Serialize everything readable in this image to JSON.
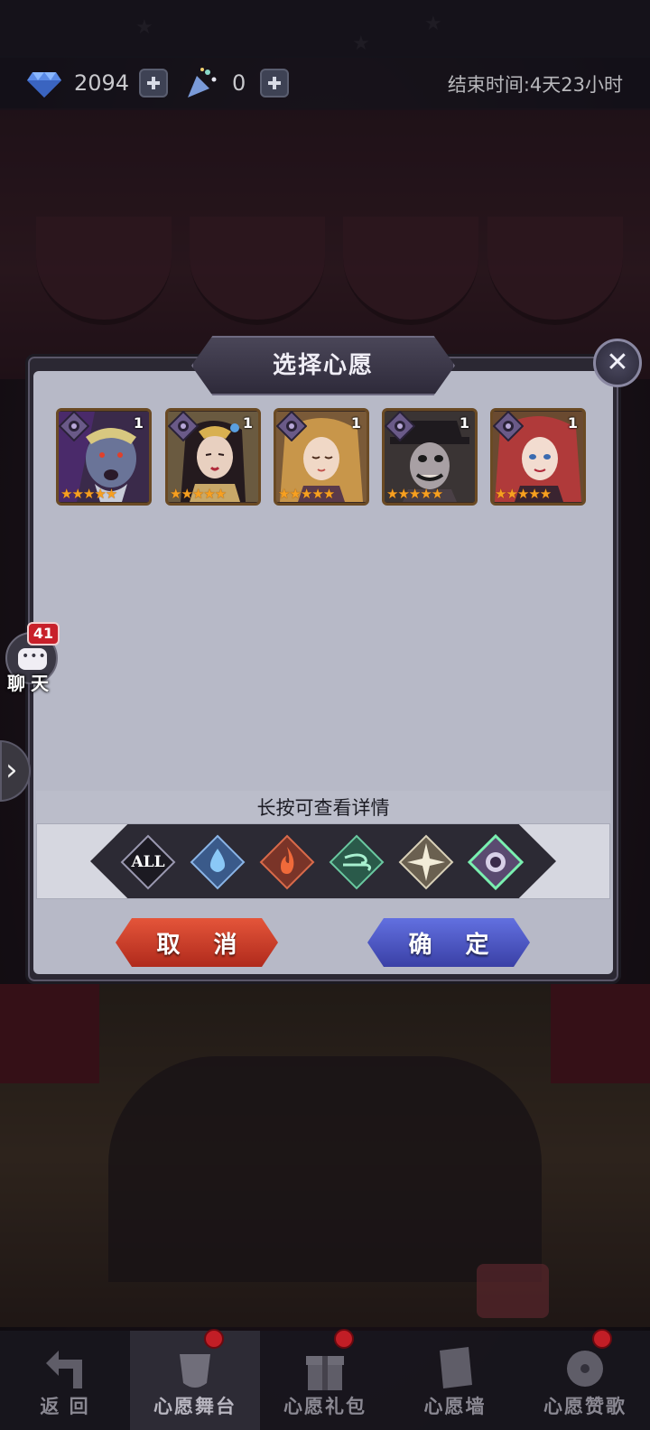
{
  "resources": {
    "gems": "2094",
    "tickets": "0",
    "end_time": "结束时间:4天23小时"
  },
  "dialog": {
    "title": "选择心愿",
    "hint": "长按可查看详情",
    "cancel_label": "取 消",
    "confirm_label": "确 定"
  },
  "heroes": [
    {
      "level": "1",
      "stars": "★★★★★",
      "faction": "shadow"
    },
    {
      "level": "1",
      "stars": "★★★★★",
      "faction": "shadow"
    },
    {
      "level": "1",
      "stars": "★★★★★",
      "faction": "shadow"
    },
    {
      "level": "1",
      "stars": "★★★★★",
      "faction": "shadow"
    },
    {
      "level": "1",
      "stars": "★★★★★",
      "faction": "shadow"
    }
  ],
  "filters": [
    {
      "label": "ALL",
      "icon": "all-icon"
    },
    {
      "label": "",
      "icon": "water-drop-icon"
    },
    {
      "label": "",
      "icon": "fire-icon"
    },
    {
      "label": "",
      "icon": "wind-icon"
    },
    {
      "label": "",
      "icon": "light-star-icon"
    },
    {
      "label": "",
      "icon": "shadow-eye-icon",
      "selected": true
    }
  ],
  "chat": {
    "badge": "41",
    "label": "聊天"
  },
  "nav": [
    {
      "label": "返 回"
    },
    {
      "label": "心愿舞台"
    },
    {
      "label": "心愿礼包"
    },
    {
      "label": "心愿墙"
    },
    {
      "label": "心愿赞歌"
    }
  ],
  "colors": {
    "cancel": "#d0412c",
    "confirm": "#4c56c8",
    "star": "#f7a020",
    "badge": "#c8202a",
    "panel": "#b7b9c7"
  }
}
